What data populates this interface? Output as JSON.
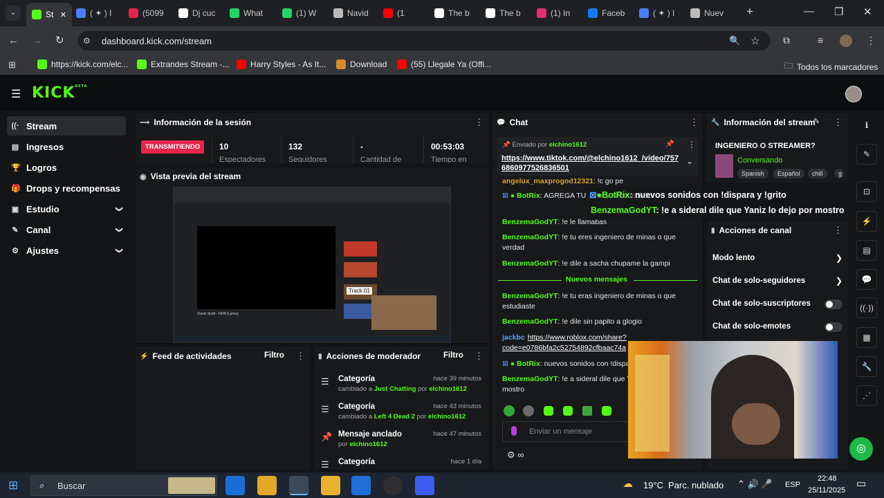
{
  "browser": {
    "tabs": [
      {
        "label": "St",
        "color": "#53fc18"
      },
      {
        "label": "( ✦ ) I",
        "color": "#4a7cf7"
      },
      {
        "label": "(5099",
        "color": "#e5254b"
      },
      {
        "label": "Dj cuc",
        "color": "#ffffff"
      },
      {
        "label": "What",
        "color": "#25d366"
      },
      {
        "label": "(1) W",
        "color": "#25d366"
      },
      {
        "label": "Navid",
        "color": "#bbbbbb"
      },
      {
        "label": "(1",
        "color": "#ff0000"
      },
      {
        "label": "The b",
        "color": "#ffffff"
      },
      {
        "label": "The b",
        "color": "#ffffff"
      },
      {
        "label": "(1) In",
        "color": "#e1306c"
      },
      {
        "label": "Faceb",
        "color": "#1877f2"
      },
      {
        "label": "( ✦ ) I",
        "color": "#4a7cf7"
      },
      {
        "label": "Nuev",
        "color": "#bbbbbb"
      }
    ],
    "url": "dashboard.kick.com/stream",
    "bookmarks": [
      {
        "label": "https://kick.com/elc...",
        "color": "#53fc18"
      },
      {
        "label": "Extrandes Stream -...",
        "color": "#53fc18"
      },
      {
        "label": "Harry Styles - As It...",
        "color": "#ff0000"
      },
      {
        "label": "Download",
        "color": "#d98b2b"
      },
      {
        "label": "(55) Llegale Ya (Offi...",
        "color": "#ff0000"
      }
    ],
    "all_bookmarks": "Todos los marcadores"
  },
  "kick": {
    "logo": "KICK",
    "logo_beta": "BETA",
    "accent": "#53fc18"
  },
  "sidebar": [
    {
      "label": "Stream",
      "icon": "wifi-icon",
      "glyph": "((·",
      "active": true
    },
    {
      "label": "Ingresos",
      "icon": "wallet-icon",
      "glyph": "▤"
    },
    {
      "label": "Logros",
      "icon": "trophy-icon",
      "glyph": "🏆"
    },
    {
      "label": "Drops y recompensas",
      "icon": "gift-icon",
      "glyph": "🎁"
    },
    {
      "label": "Estudio",
      "icon": "studio-icon",
      "glyph": "▣",
      "chevron": true
    },
    {
      "label": "Canal",
      "icon": "channel-icon",
      "glyph": "✎",
      "chevron": true
    },
    {
      "label": "Ajustes",
      "icon": "gear-icon",
      "glyph": "⚙",
      "chevron": true
    }
  ],
  "session": {
    "title": "Información de la sesión",
    "live_badge": "TRANSMITIENDO",
    "stats": [
      {
        "value": "10",
        "label": "Espectadores"
      },
      {
        "value": "132",
        "label": "Seguidores"
      },
      {
        "value": "-",
        "label": "Cantidad de"
      },
      {
        "value": "00:53:03",
        "label": "Tiempo en"
      }
    ]
  },
  "preview": {
    "title": "Vista previa del stream",
    "track_label": "Track 01",
    "preview_title": "Travis Scott - FE!N (Lyrics)"
  },
  "activity": {
    "title": "Feed de actividades",
    "filter": "Filtro"
  },
  "moderator": {
    "title": "Acciones de moderador",
    "filter": "Filtro",
    "items": [
      {
        "title": "Categoría",
        "when": "hace 39 minutos",
        "pre": "cambiado a ",
        "target": "Just Chatting",
        "mid": " por ",
        "user": "elchino1612",
        "icon": "list-icon",
        "glyph": "☰"
      },
      {
        "title": "Categoría",
        "when": "hace 43 minutos",
        "pre": "cambiado a ",
        "target": "Left 4 Dead 2",
        "mid": " por ",
        "user": "elchino1612",
        "icon": "list-icon",
        "glyph": "☰"
      },
      {
        "title": "Mensaje anclado",
        "when": "hace 47 minutos",
        "pre": "por ",
        "target": "",
        "mid": "",
        "user": "elchino1612",
        "icon": "pin-icon",
        "glyph": "📌"
      },
      {
        "title": "Categoría",
        "when": "hace 1 día",
        "pre": "",
        "target": "",
        "mid": "",
        "user": "",
        "icon": "list-icon",
        "glyph": "☰"
      }
    ]
  },
  "chat": {
    "title": "Chat",
    "pinned_by": "Enviado por",
    "pinned_user": "elchino1612",
    "pinned_link": "https://www.tiktok.com/@elchino1612_/video/757 6860977526836501",
    "messages": [
      {
        "user": "angelux_maxprogod12321",
        "text": ": !c go pe",
        "color": "#d6a12b"
      },
      {
        "user": "BotRix",
        "text": ": AGREGA TU ... !sr y el bot con !c",
        "color": "#53fc18",
        "bot": true
      },
      {
        "user": "BenzemaGodYT",
        "text": ": !e le llamabas",
        "color": "#53fc18"
      },
      {
        "user": "BenzemaGodYT",
        "text": ": !e tu eres ingeniero de minas o que verdad",
        "color": "#53fc18"
      },
      {
        "user": "BenzemaGodYT",
        "text": ": !e dile a sacha chupame la gampi",
        "color": "#53fc18"
      }
    ],
    "new_divider": "Nuevos mensajes",
    "messages_new": [
      {
        "user": "BenzemaGodYT",
        "text": ": !e tu eras ingeniero de minas o que estudiaste",
        "color": "#53fc18"
      },
      {
        "user": "BenzemaGodYT",
        "text": ": !e dile sin papito a glogio",
        "color": "#53fc18"
      },
      {
        "user": "jackbc",
        "text": "https://www.roblox.com/share? code=e0786bfa2c52754892cfbaac74a",
        "color": "#4da3ff",
        "link": true
      },
      {
        "user": "BotRix",
        "text": ": nuevos sonidos con !dispara",
        "color": "#53fc18",
        "bot": true
      },
      {
        "user": "BenzemaGodYT",
        "text": ": !e a sideral dile que Yaniz lo dejo por mostro",
        "color": "#53fc18"
      }
    ],
    "input_placeholder": "Enviar un mensaje"
  },
  "overlay": {
    "line1_user": "BotRix",
    "line1_text": ": nuevos sonidos con !dispara y !grito",
    "line2_user": "BenzemaGodYT",
    "line2_text": ": !e a sideral dile que Yaniz lo dejo por mostro"
  },
  "stream_info": {
    "title": "Información del stream",
    "stream_title": "INGENIERO O STREAMER?",
    "category": "Conversando",
    "tags": [
      "Spanish",
      "Español",
      "chill",
      "g"
    ]
  },
  "channel_actions": {
    "title": "Acciones de canal",
    "items": [
      {
        "label": "Modo lento",
        "control": "chevron"
      },
      {
        "label": "Chat de solo-seguidores",
        "control": "chevron"
      },
      {
        "label": "Chat de solo-suscriptores",
        "control": "toggle"
      },
      {
        "label": "Chat de solo-emotes",
        "control": "toggle"
      }
    ]
  },
  "taskbar": {
    "search": "Buscar",
    "weather": "19°C",
    "weather_text": "Parc. nublado",
    "lang": "ESP",
    "time": "22:48",
    "date": "25/11/2025"
  }
}
